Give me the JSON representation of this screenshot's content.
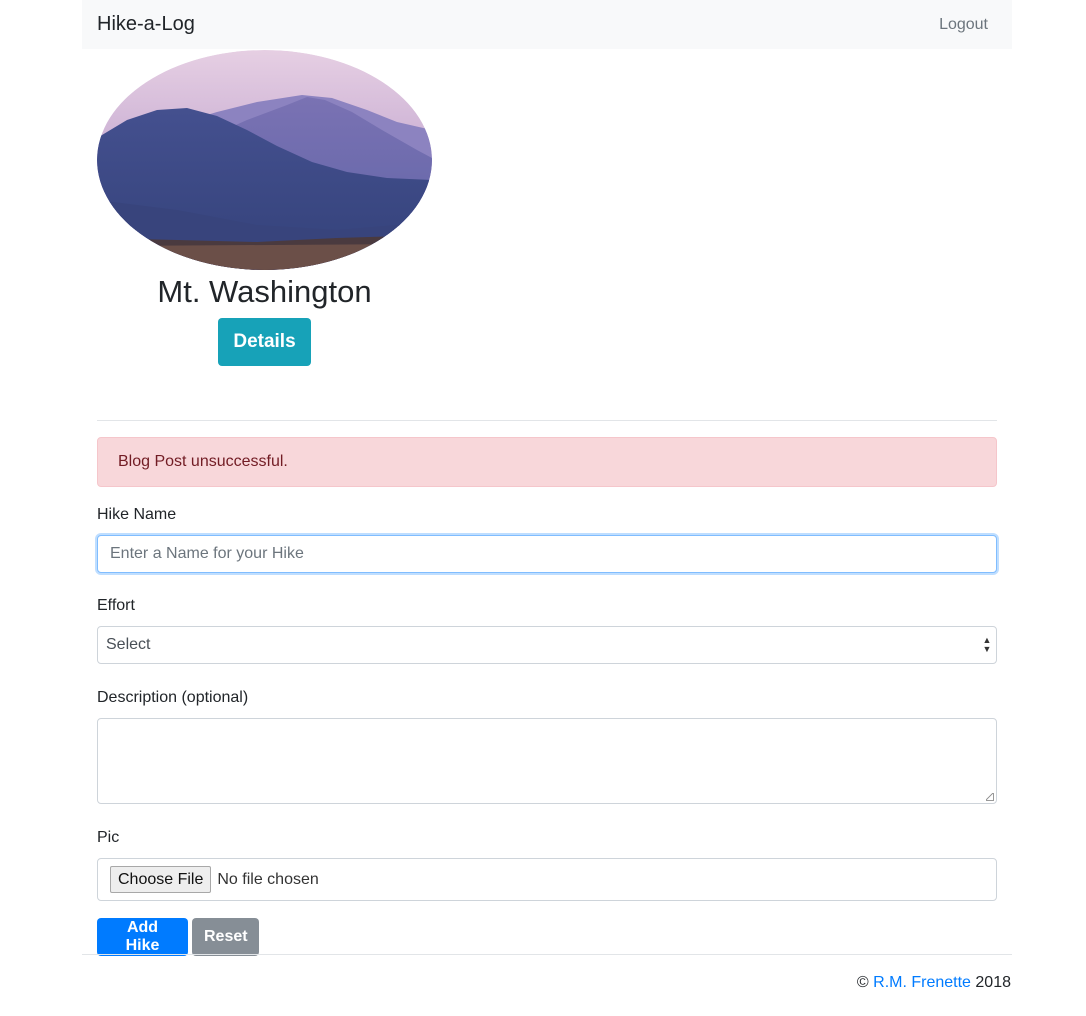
{
  "navbar": {
    "brand": "Hike-a-Log",
    "logout_label": "Logout"
  },
  "hike_card": {
    "photo_icon": "mountain-landscape-photo",
    "title": "Mt. Washington",
    "details_label": "Details"
  },
  "alert": {
    "message": "Blog Post unsuccessful."
  },
  "form": {
    "hike_name_label": "Hike Name",
    "hike_name_value": "",
    "hike_name_placeholder": "Enter a Name for your Hike",
    "effort_label": "Effort",
    "effort_selected": "Select",
    "description_label": "Description (optional)",
    "description_value": "",
    "pic_label": "Pic",
    "choose_file_label": "Choose File",
    "file_status": "No file chosen",
    "add_label": "Add Hike",
    "reset_label": "Reset"
  },
  "footer": {
    "copyright_symbol": "©",
    "author": "R.M. Frenette",
    "year": "2018"
  },
  "colors": {
    "primary": "#007bff",
    "info": "#17a2b8",
    "secondary": "#868e96",
    "alert_bg": "#f8d7da",
    "alert_text": "#721c24"
  }
}
